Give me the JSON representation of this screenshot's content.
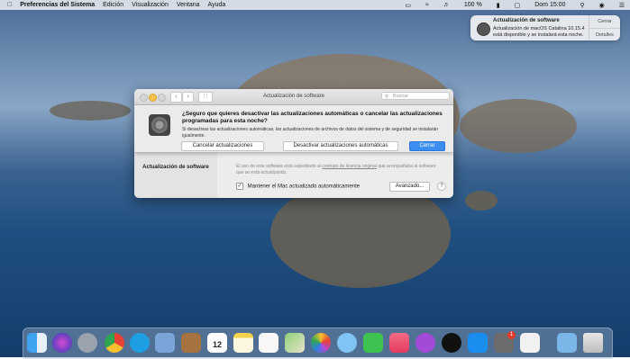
{
  "menubar": {
    "app": "Preferencias del Sistema",
    "items": [
      "Edición",
      "Visualización",
      "Ventana",
      "Ayuda"
    ],
    "battery": "100 %",
    "clock": "Dom 15:00"
  },
  "notification": {
    "title": "Actualización de software",
    "body": "Actualización de macOS Catalina 10.15.4 está disponible y se instalará esta noche.",
    "close_label": "Cerrar",
    "details_label": "Detalles"
  },
  "window": {
    "title": "Actualización de software",
    "search_placeholder": "Buscar",
    "pane_title": "Actualización de software",
    "info_text": "El uso de este software está supeditado al",
    "license_link": "contrato de licencia original",
    "info_text_end": "que acompañaba al software que se está actualizando.",
    "auto_update_label": "Mantener el Mac actualizado automáticamente",
    "advanced_label": "Avanzado...",
    "help_label": "?"
  },
  "sheet": {
    "question": "¿Seguro que quieres desactivar las actualizaciones automáticas o cancelar las actualizaciones programadas para esta noche?",
    "detail": "Si desactivas las actualizaciones automáticas, las actualizaciones de archivos de datos del sistema y de seguridad se instalarán igualmente.",
    "cancel_label": "Cancelar actualizaciones",
    "disable_label": "Desactivar actualizaciones automáticas",
    "close_label": "Cerrar"
  },
  "dock": {
    "calendar_day": "12",
    "appstore_badge": "1"
  },
  "colors": {
    "accent": "#3b8ef0"
  }
}
